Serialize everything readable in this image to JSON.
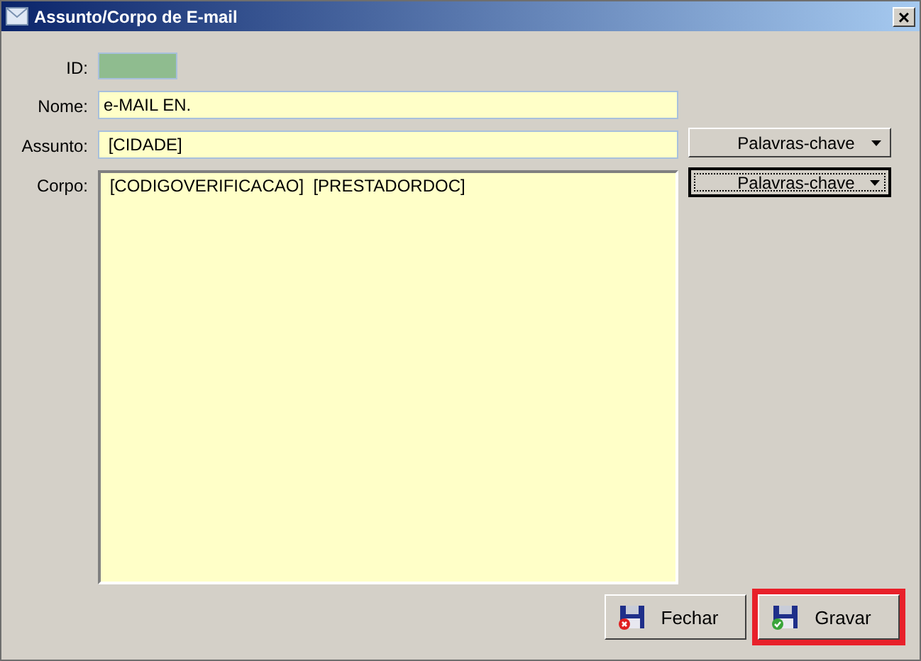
{
  "window": {
    "title": "Assunto/Corpo de E-mail",
    "close": "×"
  },
  "fields": [
    {
      "label": "ID:",
      "kind": "id"
    },
    {
      "label": "Nome:",
      "kind": "text",
      "value": "e-MAIL EN."
    },
    {
      "label": "Assunto:",
      "kind": "text",
      "value": " [CIDADE]",
      "button": {
        "label": "Palavras-chave",
        "focused": false
      }
    },
    {
      "label": "Corpo:",
      "kind": "area",
      "value": " [CODIGOVERIFICACAO]  [PRESTADORDOC]",
      "button": {
        "label": "Palavras-chave",
        "focused": true
      }
    }
  ],
  "buttons": [
    {
      "label": "Fechar",
      "kind": "close",
      "highlighted": false
    },
    {
      "label": "Gravar",
      "kind": "save",
      "highlighted": true
    }
  ]
}
